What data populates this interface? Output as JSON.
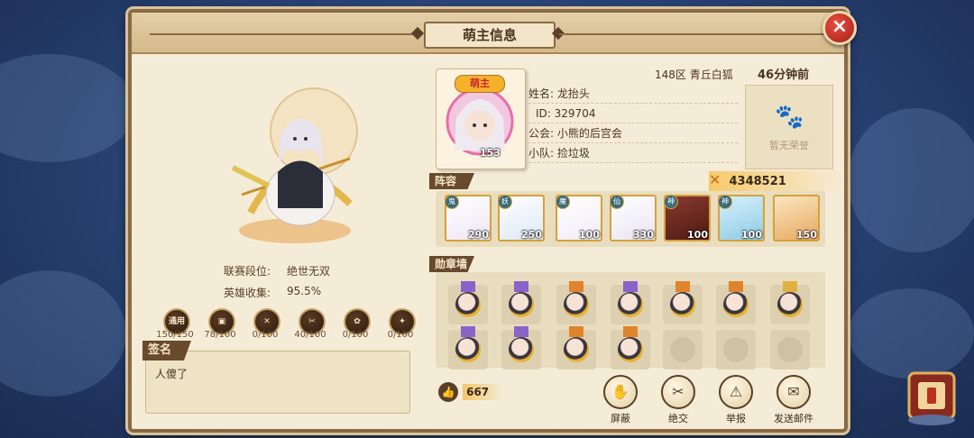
{
  "panel": {
    "title": "萌主信息",
    "close_icon": "×"
  },
  "player": {
    "server": "148区 青丘白狐",
    "last_seen": "46分钟前",
    "avatar_badge": "萌主",
    "level": "153",
    "name_label": "姓名:",
    "name": "龙抬头",
    "id_label": "ID:",
    "id": "329704",
    "guild_label": "公会:",
    "guild": "小熊的后宫会",
    "team_label": "小队:",
    "team": "捡垃圾",
    "honor_text": "暂无荣誉"
  },
  "stats": {
    "league_label": "联赛段位:",
    "league_value": "绝世无双",
    "collection_label": "英雄收集:",
    "collection_value": "95.5%"
  },
  "categories": [
    {
      "badge": "通用",
      "count": "150/150"
    },
    {
      "badge": "",
      "count": "78/100"
    },
    {
      "badge": "",
      "count": "0/100"
    },
    {
      "badge": "",
      "count": "40/100"
    },
    {
      "badge": "",
      "count": "0/100"
    },
    {
      "badge": "",
      "count": "0/100"
    }
  ],
  "signature": {
    "title": "签名",
    "text": "人傻了"
  },
  "lineup": {
    "title": "阵容",
    "power": "4348521",
    "heroes": [
      {
        "tag": "鬼",
        "level": "290",
        "color": "#efe6f6"
      },
      {
        "tag": "妖",
        "level": "250",
        "color": "#dde8f8"
      },
      {
        "tag": "魔",
        "level": "100",
        "color": "#f0ecf6"
      },
      {
        "tag": "仙",
        "level": "330",
        "color": "#e8e4f4"
      },
      {
        "tag": "神",
        "level": "100",
        "color": "#7a2a22"
      },
      {
        "tag": "神",
        "level": "100",
        "color": "#bfe6f4"
      },
      {
        "tag": "",
        "level": "150",
        "color": "#f3d6a2"
      }
    ]
  },
  "medals": {
    "title": "勋章墙",
    "row1": [
      {
        "ribbon": "#8a62c8",
        "filled": true
      },
      {
        "ribbon": "#8a62c8",
        "filled": true
      },
      {
        "ribbon": "#e0842c",
        "filled": true
      },
      {
        "ribbon": "#8a62c8",
        "filled": true
      },
      {
        "ribbon": "#e0842c",
        "filled": true
      },
      {
        "ribbon": "#e0842c",
        "filled": true
      },
      {
        "ribbon": "#e0b040",
        "filled": true
      }
    ],
    "row2": [
      {
        "ribbon": "#8a62c8",
        "filled": true
      },
      {
        "ribbon": "#8a62c8",
        "filled": true
      },
      {
        "ribbon": "#e0842c",
        "filled": true
      },
      {
        "ribbon": "#e0842c",
        "filled": true
      },
      {
        "ribbon": "",
        "filled": false
      },
      {
        "ribbon": "",
        "filled": false
      },
      {
        "ribbon": "",
        "filled": false
      }
    ]
  },
  "likes": {
    "count": "667"
  },
  "actions": {
    "block": "屏蔽",
    "unfriend": "绝交",
    "report": "举报",
    "mail": "发送邮件"
  }
}
